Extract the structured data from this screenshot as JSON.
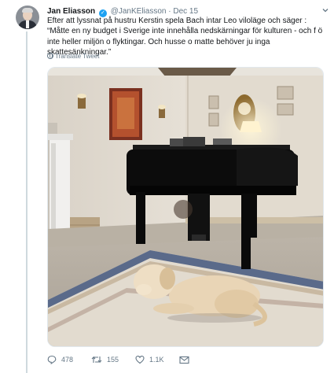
{
  "tweet": {
    "author_name": "Jan Eliasson",
    "verified_icon": "verified-badge-icon",
    "handle": "@JanKEliasson",
    "separator": "·",
    "date": "Dec 15",
    "text": "Efter att lyssnat på hustru Kerstin spela Bach intar Leo viloläge och säger : “Måtte en ny budget i Sverige inte innehålla nedskärningar för kulturen - och f ö inte heller miljön o flyktingar. Och husse o matte behöver ju inga skattesänkningar.”",
    "translate_label": "Translate Tweet",
    "menu_icon": "chevron-down-icon"
  },
  "actions": {
    "reply_count": "478",
    "retweet_count": "155",
    "like_count": "1.1K",
    "reply_icon": "reply-icon",
    "retweet_icon": "retweet-icon",
    "like_icon": "heart-icon",
    "dm_icon": "envelope-icon"
  },
  "colors": {
    "accent": "#1da1f2",
    "secondary_text": "#657786",
    "thread_line": "#cfd9de"
  }
}
